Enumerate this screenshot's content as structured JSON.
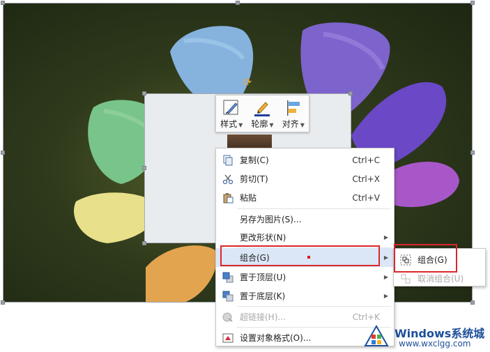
{
  "toolbar": {
    "style_label": "样式",
    "outline_label": "轮廓",
    "align_label": "对齐"
  },
  "menu": {
    "items": [
      {
        "label": "复制(C)",
        "shortcut": "Ctrl+C",
        "icon": "copy-icon"
      },
      {
        "label": "剪切(T)",
        "shortcut": "Ctrl+X",
        "icon": "scissors-icon"
      },
      {
        "label": "粘贴",
        "shortcut": "Ctrl+V",
        "icon": "paste-icon"
      },
      {
        "label": "另存为图片(S)...",
        "shortcut": "",
        "icon": ""
      },
      {
        "label": "更改形状(N)",
        "shortcut": "",
        "icon": ""
      },
      {
        "label": "组合(G)",
        "shortcut": "",
        "icon": ""
      },
      {
        "label": "置于顶层(U)",
        "shortcut": "",
        "icon": "bring-to-front-icon"
      },
      {
        "label": "置于底层(K)",
        "shortcut": "",
        "icon": "send-to-back-icon"
      },
      {
        "label": "超链接(H)...",
        "shortcut": "Ctrl+K",
        "icon": "hyperlink-icon"
      },
      {
        "label": "设置对象格式(O)...",
        "shortcut": "",
        "icon": "format-object-icon"
      }
    ]
  },
  "submenu": {
    "items": [
      {
        "label": "组合(G)",
        "icon": "group-icon"
      },
      {
        "label": "取消组合(U)",
        "icon": "ungroup-icon"
      }
    ]
  },
  "watermark": {
    "title": "Windows系统城",
    "url": "www.wxclgg.com"
  },
  "colors": {
    "menu_highlight": "#dbe6f6",
    "annotation_red": "#d9262b",
    "rotate_handle": "#e8a431"
  }
}
